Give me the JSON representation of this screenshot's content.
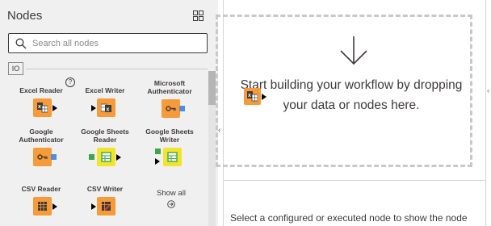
{
  "panel": {
    "title": "Nodes",
    "search_placeholder": "Search all nodes",
    "category_tag": "IO",
    "help_glyph": "?",
    "show_all_label": "Show all"
  },
  "nodes": [
    {
      "label": "Excel Reader",
      "icon": "excel-table-icon",
      "color": "#f79b3a"
    },
    {
      "label": "Excel Writer",
      "icon": "excel-writer-icon",
      "color": "#f79b3a"
    },
    {
      "label": "Microsoft Authenticator",
      "icon": "key-icon",
      "color": "#f79b3a"
    },
    {
      "label": "Google Authenticator",
      "icon": "key-icon",
      "color": "#f79b3a"
    },
    {
      "label": "Google Sheets Reader",
      "icon": "sheet-icon",
      "color": "#f4e32c"
    },
    {
      "label": "Google Sheets Writer",
      "icon": "sheet-icon",
      "color": "#f4e32c"
    },
    {
      "label": "CSV Reader",
      "icon": "csv-table-icon",
      "color": "#f79b3a"
    },
    {
      "label": "CSV Writer",
      "icon": "csv-writer-icon",
      "color": "#f79b3a"
    }
  ],
  "canvas": {
    "placeholder": "Start building your workflow by dropping your data or nodes here."
  },
  "description": {
    "text": "Select a configured or executed node to show the node"
  },
  "colors": {
    "panel_bg": "#f0f0f0",
    "source_node": "#f79b3a",
    "sheet_node": "#f4e32c",
    "port_data": "#000000",
    "port_credential": "#4a8fe0",
    "port_table": "#3aa84a"
  }
}
